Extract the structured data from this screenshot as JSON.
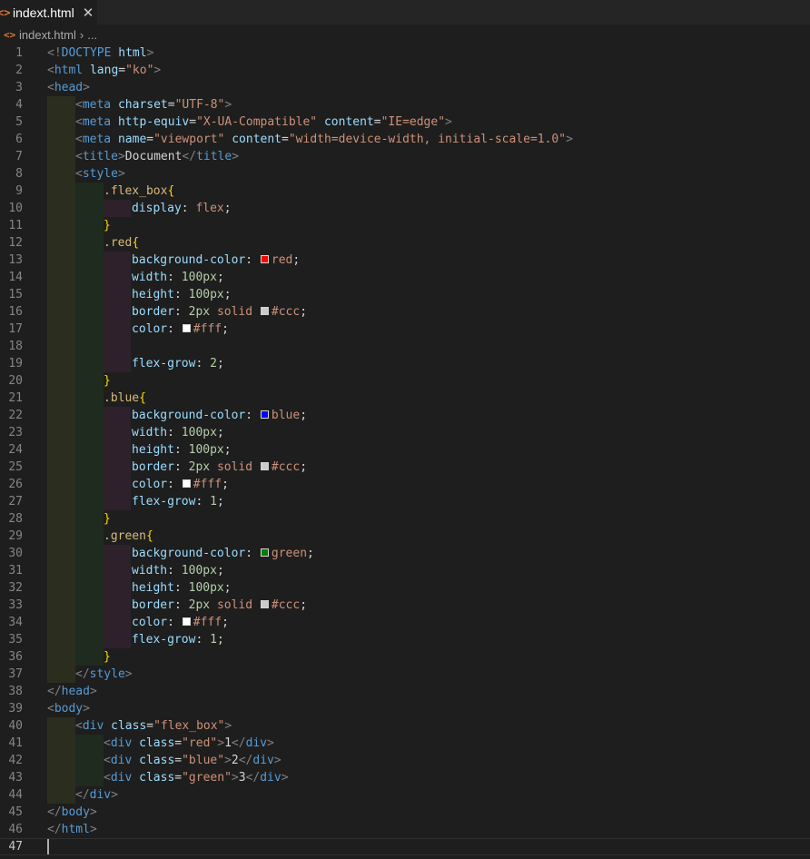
{
  "tab": {
    "label": "indext.html",
    "icon": "html-file-icon",
    "close_icon": "close-icon"
  },
  "breadcrumb": {
    "file": "indext.html",
    "more": "..."
  },
  "colors": {
    "red": "#ff0000",
    "blue": "#0000ff",
    "green": "#008000",
    "ccc": "#cccccc",
    "fff": "#ffffff"
  },
  "editor": {
    "active_line": 47,
    "lines": [
      {
        "n": "1",
        "indent": 0,
        "tokens": [
          [
            "t",
            "<!"
          ],
          [
            "tg",
            "DOCTYPE"
          ],
          [
            "tx",
            " "
          ],
          [
            "at",
            "html"
          ],
          [
            "t",
            ">"
          ]
        ]
      },
      {
        "n": "2",
        "indent": 0,
        "tokens": [
          [
            "t",
            "<"
          ],
          [
            "tg",
            "html"
          ],
          [
            "tx",
            " "
          ],
          [
            "at",
            "lang"
          ],
          [
            "tx",
            "="
          ],
          [
            "st",
            "\"ko\""
          ],
          [
            "t",
            ">"
          ]
        ]
      },
      {
        "n": "3",
        "indent": 0,
        "tokens": [
          [
            "t",
            "<"
          ],
          [
            "tg",
            "head"
          ],
          [
            "t",
            ">"
          ]
        ]
      },
      {
        "n": "4",
        "indent": 1,
        "tokens": [
          [
            "t",
            "<"
          ],
          [
            "tg",
            "meta"
          ],
          [
            "tx",
            " "
          ],
          [
            "at",
            "charset"
          ],
          [
            "tx",
            "="
          ],
          [
            "st",
            "\"UTF-8\""
          ],
          [
            "t",
            ">"
          ]
        ]
      },
      {
        "n": "5",
        "indent": 1,
        "tokens": [
          [
            "t",
            "<"
          ],
          [
            "tg",
            "meta"
          ],
          [
            "tx",
            " "
          ],
          [
            "at",
            "http-equiv"
          ],
          [
            "tx",
            "="
          ],
          [
            "st",
            "\"X-UA-Compatible\""
          ],
          [
            "tx",
            " "
          ],
          [
            "at",
            "content"
          ],
          [
            "tx",
            "="
          ],
          [
            "st",
            "\"IE=edge\""
          ],
          [
            "t",
            ">"
          ]
        ]
      },
      {
        "n": "6",
        "indent": 1,
        "tokens": [
          [
            "t",
            "<"
          ],
          [
            "tg",
            "meta"
          ],
          [
            "tx",
            " "
          ],
          [
            "at",
            "name"
          ],
          [
            "tx",
            "="
          ],
          [
            "st",
            "\"viewport\""
          ],
          [
            "tx",
            " "
          ],
          [
            "at",
            "content"
          ],
          [
            "tx",
            "="
          ],
          [
            "st",
            "\"width=device-width, initial-scale=1.0\""
          ],
          [
            "t",
            ">"
          ]
        ]
      },
      {
        "n": "7",
        "indent": 1,
        "tokens": [
          [
            "t",
            "<"
          ],
          [
            "tg",
            "title"
          ],
          [
            "t",
            ">"
          ],
          [
            "tx",
            "Document"
          ],
          [
            "t",
            "</"
          ],
          [
            "tg",
            "title"
          ],
          [
            "t",
            ">"
          ]
        ]
      },
      {
        "n": "8",
        "indent": 1,
        "tokens": [
          [
            "t",
            "<"
          ],
          [
            "tg",
            "style"
          ],
          [
            "t",
            ">"
          ]
        ]
      },
      {
        "n": "9",
        "indent": 2,
        "tokens": [
          [
            "sel",
            ".flex_box"
          ],
          [
            "br",
            "{"
          ]
        ]
      },
      {
        "n": "10",
        "indent": 3,
        "tokens": [
          [
            "at",
            "display"
          ],
          [
            "tx",
            ": "
          ],
          [
            "st",
            "flex"
          ],
          [
            "tx",
            ";"
          ]
        ]
      },
      {
        "n": "11",
        "indent": 2,
        "tokens": [
          [
            "br",
            "}"
          ]
        ]
      },
      {
        "n": "12",
        "indent": 2,
        "tokens": [
          [
            "sel",
            ".red"
          ],
          [
            "br",
            "{"
          ]
        ]
      },
      {
        "n": "13",
        "indent": 3,
        "tokens": [
          [
            "at",
            "background-color"
          ],
          [
            "tx",
            ": "
          ],
          [
            "sw",
            "red"
          ],
          [
            "st",
            "red"
          ],
          [
            "tx",
            ";"
          ]
        ]
      },
      {
        "n": "14",
        "indent": 3,
        "tokens": [
          [
            "at",
            "width"
          ],
          [
            "tx",
            ": "
          ],
          [
            "nm",
            "100px"
          ],
          [
            "tx",
            ";"
          ]
        ]
      },
      {
        "n": "15",
        "indent": 3,
        "tokens": [
          [
            "at",
            "height"
          ],
          [
            "tx",
            ": "
          ],
          [
            "nm",
            "100px"
          ],
          [
            "tx",
            ";"
          ]
        ]
      },
      {
        "n": "16",
        "indent": 3,
        "tokens": [
          [
            "at",
            "border"
          ],
          [
            "tx",
            ": "
          ],
          [
            "nm",
            "2px"
          ],
          [
            "tx",
            " "
          ],
          [
            "st",
            "solid"
          ],
          [
            "tx",
            " "
          ],
          [
            "sw",
            "ccc"
          ],
          [
            "st",
            "#ccc"
          ],
          [
            "tx",
            ";"
          ]
        ]
      },
      {
        "n": "17",
        "indent": 3,
        "tokens": [
          [
            "at",
            "color"
          ],
          [
            "tx",
            ": "
          ],
          [
            "sw",
            "fff"
          ],
          [
            "st",
            "#fff"
          ],
          [
            "tx",
            ";"
          ]
        ]
      },
      {
        "n": "18",
        "indent": 3,
        "tokens": []
      },
      {
        "n": "19",
        "indent": 3,
        "tokens": [
          [
            "at",
            "flex-grow"
          ],
          [
            "tx",
            ": "
          ],
          [
            "nm",
            "2"
          ],
          [
            "tx",
            ";"
          ]
        ]
      },
      {
        "n": "20",
        "indent": 2,
        "tokens": [
          [
            "br",
            "}"
          ]
        ]
      },
      {
        "n": "21",
        "indent": 2,
        "tokens": [
          [
            "sel",
            ".blue"
          ],
          [
            "br",
            "{"
          ]
        ]
      },
      {
        "n": "22",
        "indent": 3,
        "tokens": [
          [
            "at",
            "background-color"
          ],
          [
            "tx",
            ": "
          ],
          [
            "sw",
            "blue"
          ],
          [
            "st",
            "blue"
          ],
          [
            "tx",
            ";"
          ]
        ]
      },
      {
        "n": "23",
        "indent": 3,
        "tokens": [
          [
            "at",
            "width"
          ],
          [
            "tx",
            ": "
          ],
          [
            "nm",
            "100px"
          ],
          [
            "tx",
            ";"
          ]
        ]
      },
      {
        "n": "24",
        "indent": 3,
        "tokens": [
          [
            "at",
            "height"
          ],
          [
            "tx",
            ": "
          ],
          [
            "nm",
            "100px"
          ],
          [
            "tx",
            ";"
          ]
        ]
      },
      {
        "n": "25",
        "indent": 3,
        "tokens": [
          [
            "at",
            "border"
          ],
          [
            "tx",
            ": "
          ],
          [
            "nm",
            "2px"
          ],
          [
            "tx",
            " "
          ],
          [
            "st",
            "solid"
          ],
          [
            "tx",
            " "
          ],
          [
            "sw",
            "ccc"
          ],
          [
            "st",
            "#ccc"
          ],
          [
            "tx",
            ";"
          ]
        ]
      },
      {
        "n": "26",
        "indent": 3,
        "tokens": [
          [
            "at",
            "color"
          ],
          [
            "tx",
            ": "
          ],
          [
            "sw",
            "fff"
          ],
          [
            "st",
            "#fff"
          ],
          [
            "tx",
            ";"
          ]
        ]
      },
      {
        "n": "27",
        "indent": 3,
        "tokens": [
          [
            "at",
            "flex-grow"
          ],
          [
            "tx",
            ": "
          ],
          [
            "nm",
            "1"
          ],
          [
            "tx",
            ";"
          ]
        ]
      },
      {
        "n": "28",
        "indent": 2,
        "tokens": [
          [
            "br",
            "}"
          ]
        ]
      },
      {
        "n": "29",
        "indent": 2,
        "tokens": [
          [
            "sel",
            ".green"
          ],
          [
            "br",
            "{"
          ]
        ]
      },
      {
        "n": "30",
        "indent": 3,
        "tokens": [
          [
            "at",
            "background-color"
          ],
          [
            "tx",
            ": "
          ],
          [
            "sw",
            "green"
          ],
          [
            "st",
            "green"
          ],
          [
            "tx",
            ";"
          ]
        ]
      },
      {
        "n": "31",
        "indent": 3,
        "tokens": [
          [
            "at",
            "width"
          ],
          [
            "tx",
            ": "
          ],
          [
            "nm",
            "100px"
          ],
          [
            "tx",
            ";"
          ]
        ]
      },
      {
        "n": "32",
        "indent": 3,
        "tokens": [
          [
            "at",
            "height"
          ],
          [
            "tx",
            ": "
          ],
          [
            "nm",
            "100px"
          ],
          [
            "tx",
            ";"
          ]
        ]
      },
      {
        "n": "33",
        "indent": 3,
        "tokens": [
          [
            "at",
            "border"
          ],
          [
            "tx",
            ": "
          ],
          [
            "nm",
            "2px"
          ],
          [
            "tx",
            " "
          ],
          [
            "st",
            "solid"
          ],
          [
            "tx",
            " "
          ],
          [
            "sw",
            "ccc"
          ],
          [
            "st",
            "#ccc"
          ],
          [
            "tx",
            ";"
          ]
        ]
      },
      {
        "n": "34",
        "indent": 3,
        "tokens": [
          [
            "at",
            "color"
          ],
          [
            "tx",
            ": "
          ],
          [
            "sw",
            "fff"
          ],
          [
            "st",
            "#fff"
          ],
          [
            "tx",
            ";"
          ]
        ]
      },
      {
        "n": "35",
        "indent": 3,
        "tokens": [
          [
            "at",
            "flex-grow"
          ],
          [
            "tx",
            ": "
          ],
          [
            "nm",
            "1"
          ],
          [
            "tx",
            ";"
          ]
        ]
      },
      {
        "n": "36",
        "indent": 2,
        "tokens": [
          [
            "br",
            "}"
          ]
        ]
      },
      {
        "n": "37",
        "indent": 1,
        "tokens": [
          [
            "t",
            "</"
          ],
          [
            "tg",
            "style"
          ],
          [
            "t",
            ">"
          ]
        ]
      },
      {
        "n": "38",
        "indent": 0,
        "tokens": [
          [
            "t",
            "</"
          ],
          [
            "tg",
            "head"
          ],
          [
            "t",
            ">"
          ]
        ]
      },
      {
        "n": "39",
        "indent": 0,
        "tokens": [
          [
            "t",
            "<"
          ],
          [
            "tg",
            "body"
          ],
          [
            "t",
            ">"
          ]
        ]
      },
      {
        "n": "40",
        "indent": 1,
        "tokens": [
          [
            "t",
            "<"
          ],
          [
            "tg",
            "div"
          ],
          [
            "tx",
            " "
          ],
          [
            "at",
            "class"
          ],
          [
            "tx",
            "="
          ],
          [
            "st",
            "\"flex_box\""
          ],
          [
            "t",
            ">"
          ]
        ]
      },
      {
        "n": "41",
        "indent": 2,
        "tokens": [
          [
            "t",
            "<"
          ],
          [
            "tg",
            "div"
          ],
          [
            "tx",
            " "
          ],
          [
            "at",
            "class"
          ],
          [
            "tx",
            "="
          ],
          [
            "st",
            "\"red\""
          ],
          [
            "t",
            ">"
          ],
          [
            "tx",
            "1"
          ],
          [
            "t",
            "</"
          ],
          [
            "tg",
            "div"
          ],
          [
            "t",
            ">"
          ]
        ]
      },
      {
        "n": "42",
        "indent": 2,
        "tokens": [
          [
            "t",
            "<"
          ],
          [
            "tg",
            "div"
          ],
          [
            "tx",
            " "
          ],
          [
            "at",
            "class"
          ],
          [
            "tx",
            "="
          ],
          [
            "st",
            "\"blue\""
          ],
          [
            "t",
            ">"
          ],
          [
            "tx",
            "2"
          ],
          [
            "t",
            "</"
          ],
          [
            "tg",
            "div"
          ],
          [
            "t",
            ">"
          ]
        ]
      },
      {
        "n": "43",
        "indent": 2,
        "tokens": [
          [
            "t",
            "<"
          ],
          [
            "tg",
            "div"
          ],
          [
            "tx",
            " "
          ],
          [
            "at",
            "class"
          ],
          [
            "tx",
            "="
          ],
          [
            "st",
            "\"green\""
          ],
          [
            "t",
            ">"
          ],
          [
            "tx",
            "3"
          ],
          [
            "t",
            "</"
          ],
          [
            "tg",
            "div"
          ],
          [
            "t",
            ">"
          ]
        ]
      },
      {
        "n": "44",
        "indent": 1,
        "tokens": [
          [
            "t",
            "</"
          ],
          [
            "tg",
            "div"
          ],
          [
            "t",
            ">"
          ]
        ]
      },
      {
        "n": "45",
        "indent": 0,
        "tokens": [
          [
            "t",
            "</"
          ],
          [
            "tg",
            "body"
          ],
          [
            "t",
            ">"
          ]
        ]
      },
      {
        "n": "46",
        "indent": 0,
        "tokens": [
          [
            "t",
            "</"
          ],
          [
            "tg",
            "html"
          ],
          [
            "t",
            ">"
          ]
        ]
      },
      {
        "n": "47",
        "indent": 0,
        "tokens": []
      }
    ]
  }
}
